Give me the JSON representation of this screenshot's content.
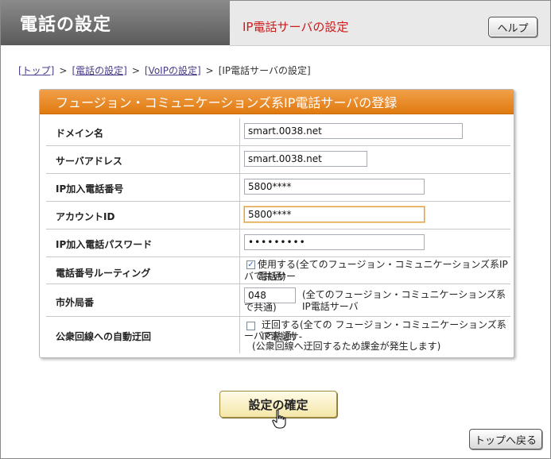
{
  "header": {
    "title": "電話の設定",
    "subtitle": "IP電話サーバの設定",
    "help_label": "ヘルプ"
  },
  "breadcrumb": {
    "items": [
      "[トップ]",
      "[電話の設定]",
      "[VoIPの設定]",
      "[IP電話サーバの設定]"
    ],
    "separator": ">"
  },
  "panel": {
    "title": "フュージョン・コミュニケーションズ系IP電話サーバの登録",
    "rows": {
      "domain": {
        "label": "ドメイン名",
        "value": "smart.0038.net"
      },
      "server": {
        "label": "サーバアドレス",
        "value": "smart.0038.net"
      },
      "number": {
        "label": "IP加入電話番号",
        "value": "5800****"
      },
      "account": {
        "label": "アカウントID",
        "value": "5800****"
      },
      "password": {
        "label": "IP加入電話パスワード",
        "value": "•••••••••"
      },
      "routing": {
        "label": "電話番号ルーティング",
        "checkbox_checked": true,
        "text_line1": "使用する(全てのフュージョン・コミュニケーションズ系IP電話サー",
        "text_line2": "バで共通)"
      },
      "area": {
        "label": "市外局番",
        "value": "048",
        "text_line1": "(全てのフュージョン・コミュニケーションズ系IP電話サーバ",
        "text_line2": "で共通)"
      },
      "fallback": {
        "label": "公衆回線への自動迂回",
        "checkbox_checked": false,
        "text_line1": "迂回する(全ての フュージョン・コミュニケーションズ系IP電話サ-",
        "text_line2": "ーバで共通)",
        "text_line3": "(公衆回線へ迂回するため課金が発生します)"
      }
    }
  },
  "buttons": {
    "confirm_label": "設定の確定",
    "top_label": "トップへ戻る"
  },
  "icons": {
    "cursor": "hand-pointer-icon",
    "checkmark": "checkmark-icon"
  },
  "colors": {
    "panel_header": "#e58a24",
    "subtitle": "#cc1a1a",
    "header_bg": "#6e6e6e"
  }
}
